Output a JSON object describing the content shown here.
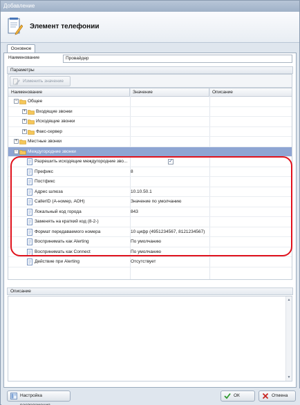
{
  "window": {
    "title": "Добавление"
  },
  "header": {
    "title": "Элемент телефонии"
  },
  "tabs": [
    {
      "label": "Основное"
    }
  ],
  "name_field": {
    "label": "Наименование",
    "value": "Провайдер"
  },
  "params": {
    "section_label": "Параметры",
    "toolbar": {
      "edit_label": "Изменить значение"
    },
    "columns": {
      "name": "Наименование",
      "value": "Значение",
      "description": "Описание"
    },
    "rows": [
      {
        "label": "Общее",
        "value": "",
        "kind": "group",
        "expander": "−"
      },
      {
        "label": "Входящие звонки",
        "value": "",
        "kind": "subgroup",
        "expander": "+"
      },
      {
        "label": "Исходящие звонки",
        "value": "",
        "kind": "subgroup",
        "expander": "+"
      },
      {
        "label": "Факс-сервер",
        "value": "",
        "kind": "subgroup",
        "expander": "+"
      },
      {
        "label": "Местные звонки",
        "value": "",
        "kind": "group",
        "expander": "+"
      },
      {
        "label": "Междугородние звонки",
        "value": "",
        "kind": "group-selected",
        "expander": "−"
      },
      {
        "label": "Разрешить исходящие междугородние зво...",
        "value": "",
        "kind": "prop-check",
        "checked": true
      },
      {
        "label": "Префикс",
        "value": "8",
        "kind": "prop"
      },
      {
        "label": "Постфикс",
        "value": "",
        "kind": "prop"
      },
      {
        "label": "Адрес шлюза",
        "value": "10.10.50.1",
        "kind": "prop"
      },
      {
        "label": "CallerID (А-номер, АОН)",
        "value": "Значение по умолчанию",
        "kind": "prop"
      },
      {
        "label": "Локальный код города",
        "value": "843",
        "kind": "prop"
      },
      {
        "label": "Заменять на краткий код (8-2-)",
        "value": "",
        "kind": "prop"
      },
      {
        "label": "Формат передаваемого номера",
        "value": "10 цифр (4951234567, 8121234567)",
        "kind": "prop"
      },
      {
        "label": "Воспринимать как Alerting",
        "value": "По умолчанию",
        "kind": "prop"
      },
      {
        "label": "Воспринимать как Connect",
        "value": "По умолчанию",
        "kind": "prop"
      },
      {
        "label": "Действие при Alerting",
        "value": "Отсутствует",
        "kind": "prop"
      }
    ]
  },
  "description": {
    "label": "Описание",
    "text": ""
  },
  "buttons": {
    "layout": "Настройка расположения",
    "ok": "ОК",
    "cancel": "Отмена"
  },
  "colors": {
    "selection": "#8ea5d3",
    "highlight_border": "#e0111b"
  }
}
